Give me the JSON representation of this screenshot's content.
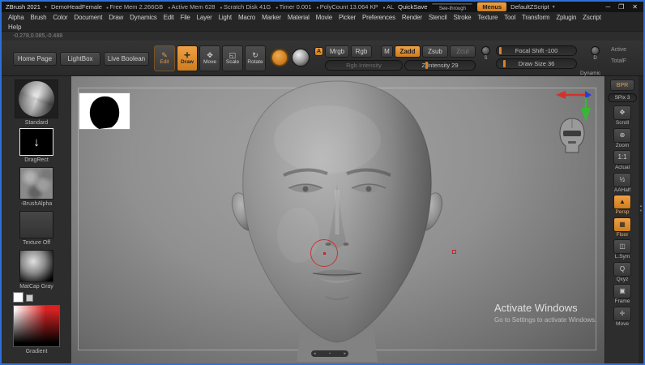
{
  "titlebar": {
    "app": "ZBrush 2021",
    "document": "DemoHeadFemale",
    "stats": [
      "Free Mem 2.266GB",
      "Active Mem 628",
      "Scratch Disk 41G",
      "Timer 0.001",
      "PolyCount 13.064 KP",
      "AL"
    ],
    "quicksave": "QuickSave",
    "see_through": "See-through",
    "menus": "Menus",
    "zscript": "DefaultZScript",
    "min": "─",
    "max": "❐",
    "close": "✕"
  },
  "menubar": {
    "items": [
      {
        "label": "Alpha"
      },
      {
        "label": "Brush"
      },
      {
        "label": "Color"
      },
      {
        "label": "Document"
      },
      {
        "label": "Draw"
      },
      {
        "label": "Dynamics"
      },
      {
        "label": "Edit"
      },
      {
        "label": "File"
      },
      {
        "label": "Layer"
      },
      {
        "label": "Light"
      },
      {
        "label": "Macro"
      },
      {
        "label": "Marker"
      },
      {
        "label": "Material"
      },
      {
        "label": "Movie"
      },
      {
        "label": "Picker"
      },
      {
        "label": "Preferences"
      },
      {
        "label": "Render"
      },
      {
        "label": "Stencil"
      },
      {
        "label": "Stroke"
      },
      {
        "label": "Texture"
      },
      {
        "label": "Tool"
      },
      {
        "label": "Transform"
      },
      {
        "label": "Zplugin"
      },
      {
        "label": "Zscript"
      }
    ],
    "help": "Help"
  },
  "coords": "-0.278,0.085,-0.488",
  "shelf": {
    "home": "Home Page",
    "lightbox": "LightBox",
    "live_boolean": "Live Boolean",
    "edit": "Edit",
    "draw": "Draw",
    "move": "Move",
    "scale": "Scale",
    "rotate": "Rotate",
    "a": "A",
    "mrgb": "Mrgb",
    "rgb": "Rgb",
    "m": "M",
    "zadd": "Zadd",
    "zsub": "Zsub",
    "zcut": "Zcut",
    "rgb_intensity": "Rgb Intensity",
    "z_intensity": "Z Intensity 29",
    "s": "S",
    "d": "D",
    "focal_shift": "Focal Shift -100",
    "draw_size": "Draw Size 36",
    "dynamic": "Dynamic",
    "active": "Active",
    "total": "TotalF"
  },
  "left_tray": {
    "items": [
      {
        "label": "Standard"
      },
      {
        "label": "DragRect"
      },
      {
        "label": "-BrushAlpha"
      },
      {
        "label": "Texture Off"
      },
      {
        "label": "MatCap Gray"
      },
      {
        "label": "Gradient"
      }
    ]
  },
  "right_tray": {
    "bpr": "BPR",
    "spix": "SPix 3",
    "items": [
      {
        "label": "Scroll",
        "icon": "hand-scroll"
      },
      {
        "label": "Zoom",
        "icon": "magnifier"
      },
      {
        "label": "Actual",
        "icon": "one-to-one"
      },
      {
        "label": "AAHalf",
        "icon": "half-aa"
      },
      {
        "label": "Persp",
        "icon": "perspective",
        "active": true
      },
      {
        "label": "Floor",
        "icon": "floor-grid",
        "active": true
      },
      {
        "label": "L.Sym",
        "icon": "local-symmetry"
      },
      {
        "label": "Qxyz",
        "icon": "axis-q"
      },
      {
        "label": "Frame",
        "icon": "frame-box"
      },
      {
        "label": "Move",
        "icon": "move-cross"
      }
    ]
  },
  "canvas": {
    "watermark_title": "Activate Windows",
    "watermark_sub": "Go to Settings to activate Windows."
  },
  "icons": {
    "pencil": "✎",
    "cross-arrows": "✛",
    "four-arrows": "✥",
    "scale-box": "◱",
    "rotate-arrow": "↻",
    "hand-scroll": "✥",
    "magnifier": "⊕",
    "one-to-one": "1:1",
    "half-aa": "½",
    "perspective": "▲",
    "floor-grid": "▦",
    "local-symmetry": "◫",
    "axis-q": "Q",
    "frame-box": "▣",
    "move-cross": "✛",
    "dropdown-arrow": "▼",
    "up-arrow": "▲",
    "down-arrow": "▼",
    "left-tri": "◂",
    "right-tri": "▸",
    "thumb-square": "▪",
    "down-plain": "↓"
  },
  "colors": {
    "accent": "#d9822a",
    "window_border": "#2f6fd8",
    "canvas_top": "#a4a4a4",
    "canvas_bottom": "#565656"
  }
}
